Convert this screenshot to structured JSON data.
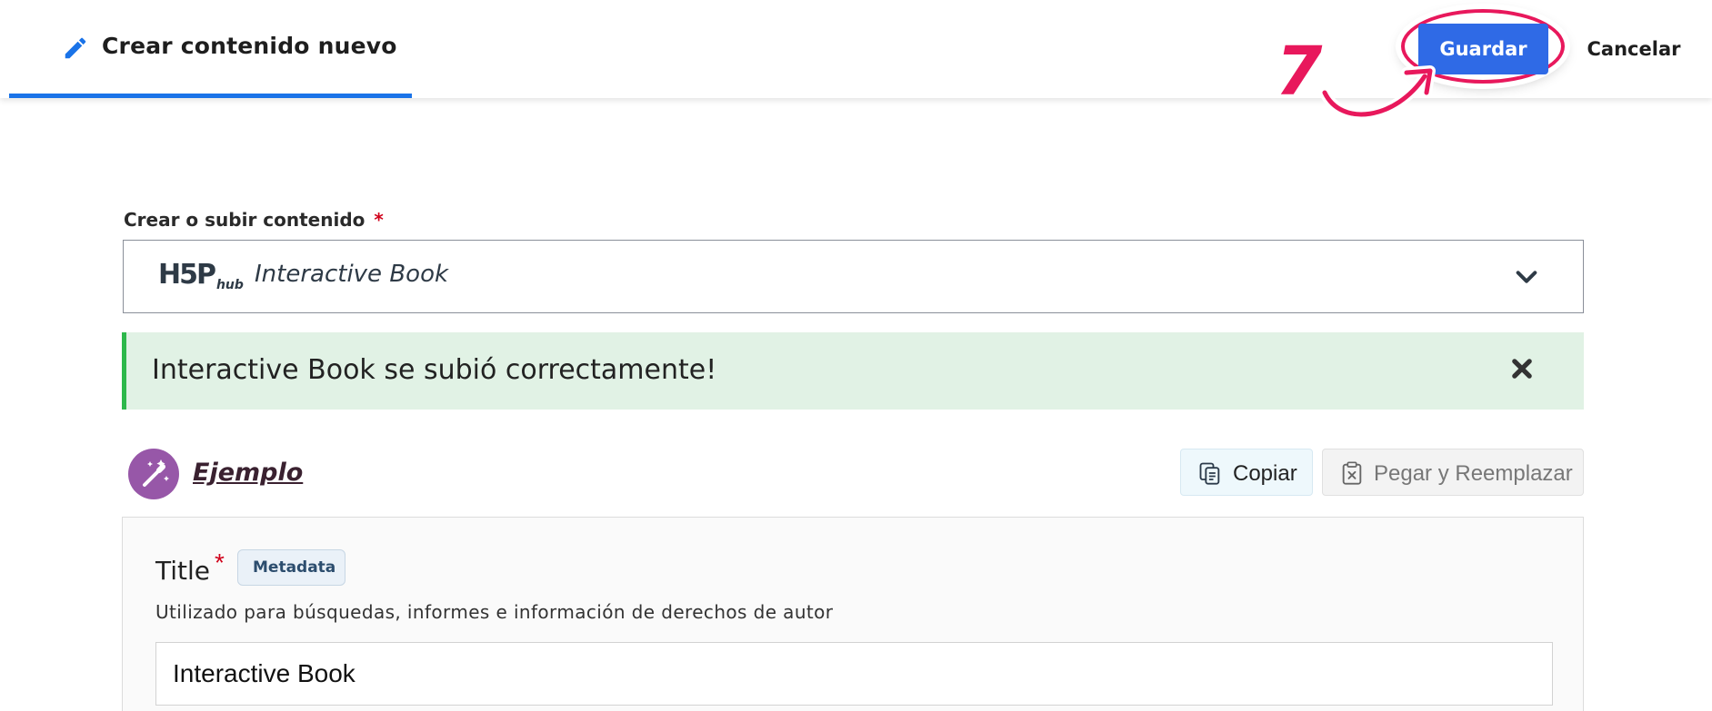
{
  "header": {
    "title": "Crear contenido nuevo",
    "save_label": "Guardar",
    "cancel_label": "Cancelar",
    "accent_color": "#1a73e8"
  },
  "annotation": {
    "step_number": "7",
    "color": "#e8185c"
  },
  "content_select": {
    "label": "Crear o subir contenido",
    "required_mark": "*",
    "logo_text": "H5P",
    "logo_sub": "hub",
    "selected_value": "Interactive Book"
  },
  "alert": {
    "message": "Interactive Book se subió correctamente!",
    "type": "success"
  },
  "example": {
    "link_label": "Ejemplo",
    "copy_label": "Copiar",
    "paste_label": "Pegar y Reemplazar"
  },
  "form": {
    "title_label": "Title",
    "required_mark": "*",
    "metadata_label": "Metadata",
    "description": "Utilizado para búsquedas, informes e información de derechos de autor",
    "title_value": "Interactive Book"
  }
}
